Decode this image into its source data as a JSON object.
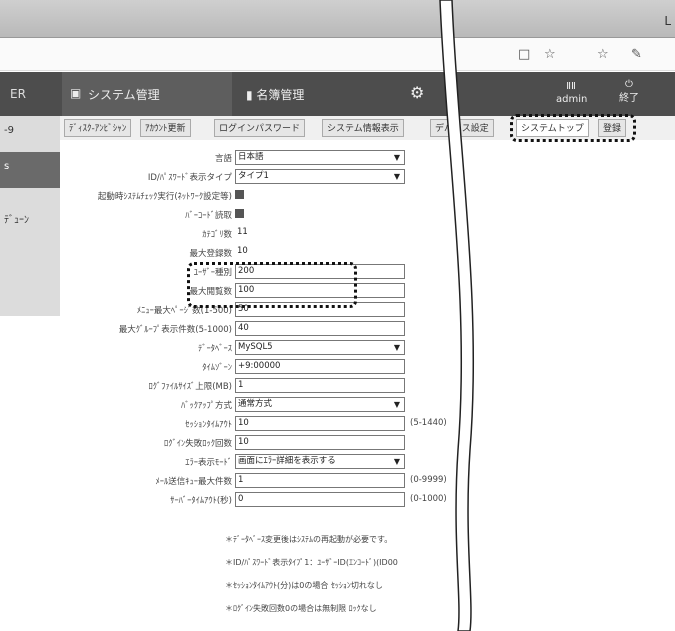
{
  "titlebar": {
    "corner_label": "L"
  },
  "toolbar": {
    "icons": [
      "page-icon",
      "star-icon",
      "favorites-icon",
      "reading-icon"
    ],
    "glyphs": [
      "□",
      "☆",
      "☆",
      "✎"
    ]
  },
  "navbar": {
    "left_label": "ER",
    "system_admin": "システム管理",
    "name_admin": "名簿管理",
    "user_label": "admin",
    "exit_label": "終了",
    "user_glyph": "ⅡⅡ",
    "exit_glyph": "⏻"
  },
  "left_nav": [
    {
      "label": "-9"
    },
    {
      "label": "s"
    },
    {
      "label": "ﾃﾞｭｰﾝ"
    }
  ],
  "tabs": [
    {
      "label": "ﾃﾞｨｽｸ-ｱﾝﾋﾞｼｬﾝ"
    },
    {
      "label": "ｱｶｳﾝﾄ更新"
    },
    {
      "label": "ログインパスワード"
    },
    {
      "label": "システム情報表示"
    },
    {
      "label": "デバイス設定"
    },
    {
      "label": "システムトップ"
    },
    {
      "label": "登録"
    }
  ],
  "form": [
    {
      "label": "言語",
      "value": "日本語",
      "kind": "select",
      "w": 170
    },
    {
      "label": "ID/ﾊﾟｽﾜｰﾄﾞ表示タイプ",
      "value": "タイプ1",
      "kind": "select",
      "w": 170
    },
    {
      "label": "起動時ｼｽﾃﾑﾁｪｯｸ実行(ﾈｯﾄﾜｰｸ設定等)",
      "value": "",
      "kind": "check"
    },
    {
      "label": "ﾊﾞｰｺｰﾄﾞ読取",
      "value": "",
      "kind": "check"
    },
    {
      "label": "ｶﾃｺﾞﾘ数",
      "value": "11",
      "kind": "plain"
    },
    {
      "label": "最大登録数",
      "value": "10",
      "kind": "plain"
    },
    {
      "label": "ﾕｰｻﾞｰ種別",
      "value": "200",
      "kind": "text",
      "w": 170
    },
    {
      "label": "最大閲覧数",
      "value": "100",
      "kind": "text",
      "w": 170
    },
    {
      "label": "ﾒﾆｭｰ最大ﾍﾟｰｼﾞ数(1-500)",
      "value": "50",
      "kind": "text",
      "w": 170
    },
    {
      "label": "最大ｸﾞﾙｰﾌﾟ表示件数(5-1000)",
      "value": "40",
      "kind": "text",
      "w": 170
    },
    {
      "label": "ﾃﾞｰﾀﾍﾞｰｽ",
      "value": "MySQL5",
      "kind": "select",
      "w": 170
    },
    {
      "label": "ﾀｲﾑｿﾞｰﾝ",
      "value": "+9:00000",
      "kind": "text",
      "w": 170
    },
    {
      "label": "ﾛｸﾞﾌｧｲﾙｻｲｽﾞ上限(MB)",
      "value": "1",
      "kind": "text",
      "w": 170
    },
    {
      "label": "ﾊﾞｯｸｱｯﾌﾟ方式",
      "value": "通常方式",
      "kind": "select",
      "w": 170
    },
    {
      "label": "ｾｯｼｮﾝﾀｲﾑｱｳﾄ",
      "value": "10",
      "kind": "text",
      "w": 170,
      "suffix": "(5-1440)"
    },
    {
      "label": "ﾛｸﾞｲﾝ失敗ﾛｯｸ回数",
      "value": "10",
      "kind": "text",
      "w": 170
    },
    {
      "label": "ｴﾗｰ表示ﾓｰﾄﾞ",
      "value": "画面にｴﾗｰ詳細を表示する",
      "kind": "select",
      "w": 170
    },
    {
      "label": "ﾒｰﾙ送信ｷｭｰ最大件数",
      "value": "1",
      "kind": "text",
      "w": 170,
      "suffix": "(0-9999)"
    },
    {
      "label": "ｻｰﾊﾞｰﾀｲﾑｱｳﾄ(秒)",
      "value": "0",
      "kind": "text",
      "w": 170,
      "suffix": "(0-1000)"
    }
  ],
  "notes": [
    "＊ﾃﾞｰﾀﾍﾞｰｽ変更後はｼｽﾃﾑの再起動が必要です。",
    "＊ID/ﾊﾟｽﾜｰﾄﾞ表示ﾀｲﾌﾟ1：ﾕｰｻﾞｰID(ｴﾝｺｰﾄﾞ)(ID00",
    "＊ｾｯｼｮﾝﾀｲﾑｱｳﾄ(分)は0の場合 ｾｯｼｮﾝ切れなし",
    "＊ﾛｸﾞｲﾝ失敗回数0の場合は無制限 ﾛｯｸなし"
  ],
  "colors": {
    "navbar": "#4d4d4d",
    "highlight": "#111111"
  }
}
